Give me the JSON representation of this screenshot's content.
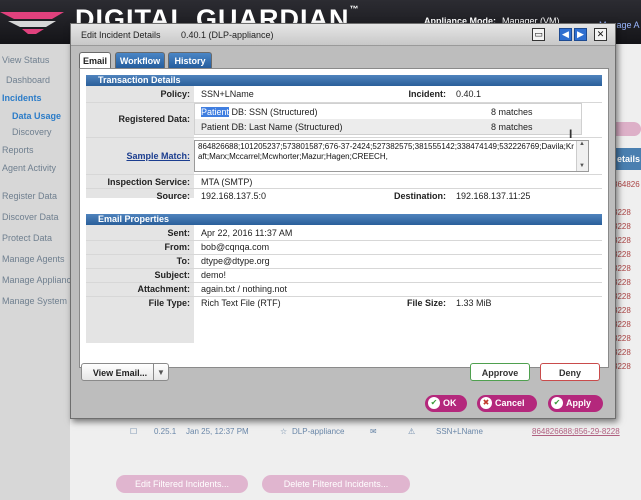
{
  "app": {
    "logo_text": "DIGITAL GUARDIAN",
    "logo_tm": "™",
    "appliance_mode_label": "Appliance Mode:",
    "appliance_mode_value": "Manager (VM)",
    "manage_link": "Manage A"
  },
  "sidebar": {
    "items": [
      {
        "label": "View Status"
      },
      {
        "label": "Dashboard"
      },
      {
        "label": "Incidents"
      },
      {
        "label": "Data Usage"
      },
      {
        "label": "Discovery"
      },
      {
        "label": "Reports"
      },
      {
        "label": "Agent Activity"
      },
      {
        "label": "Register Data"
      },
      {
        "label": "Discover Data"
      },
      {
        "label": "Protect Data"
      },
      {
        "label": "Manage Agents"
      },
      {
        "label": "Manage Applianc"
      },
      {
        "label": "Manage System"
      }
    ]
  },
  "background": {
    "details_header": "etails",
    "link_cells": [
      "864826",
      "",
      "3228",
      "3228",
      "3228",
      "3228",
      "3228",
      "3228",
      "3228",
      "3228",
      "3228",
      "3228",
      "3228",
      "3228"
    ],
    "row": {
      "id": "0.25.1",
      "date": "Jan 25, 12:37 PM",
      "source": "DLP-appliance",
      "policy": "SSN+LName",
      "data": "864826688;856-29-8228"
    },
    "edit_filtered": "Edit Filtered Incidents...",
    "delete_filtered": "Delete Filtered Incidents..."
  },
  "dialog": {
    "title": "Edit Incident Details",
    "subtitle": "0.40.1 (DLP-appliance)",
    "tabs": [
      {
        "label": "Email",
        "active": true
      },
      {
        "label": "Workflow",
        "active": false
      },
      {
        "label": "History",
        "active": false
      }
    ],
    "transaction": {
      "header": "Transaction Details",
      "policy_label": "Policy:",
      "policy_value": "SSN+LName",
      "incident_label": "Incident:",
      "incident_value": "0.40.1",
      "registered_label": "Registered Data:",
      "registered_rows": [
        {
          "name_hl": "Patient",
          "name_rest": " DB: SSN (Structured)",
          "count": "8 matches"
        },
        {
          "name_hl": "",
          "name_rest": "Patient DB: Last Name (Structured)",
          "count": "8 matches"
        }
      ],
      "sample_label": "Sample Match:",
      "sample_value": "864826688;101205237;573801587;676-37-2424;527382575;381555142;338474149;532226769;Davila;Kraft;Marx;Mccarrel;Mcwhorter;Mazur;Hagen;CREECH,",
      "inspection_label": "Inspection Service:",
      "inspection_value": "MTA (SMTP)",
      "source_label": "Source:",
      "source_value": "192.168.137.5:0",
      "destination_label": "Destination:",
      "destination_value": "192.168.137.11:25"
    },
    "email": {
      "header": "Email Properties",
      "sent_label": "Sent:",
      "sent_value": "Apr 22, 2016 11:37 AM",
      "from_label": "From:",
      "from_value": "bob@cqnqa.com",
      "to_label": "To:",
      "to_value": "dtype@dtype.org",
      "subject_label": "Subject:",
      "subject_value": "demo!",
      "attachment_label": "Attachment:",
      "attachment_value": "again.txt / nothing.not",
      "filetype_label": "File Type:",
      "filetype_value": "Rich Text File (RTF)",
      "filesize_label": "File Size:",
      "filesize_value": "1.33 MiB"
    },
    "buttons": {
      "view_email": "View Email...",
      "approve": "Approve",
      "deny": "Deny",
      "ok": "OK",
      "cancel": "Cancel",
      "apply": "Apply"
    }
  },
  "colors": {
    "accent_blue": "#2a5f9a",
    "tab_blue": "#255d9d",
    "action_magenta": "#b4287c",
    "approve_green": "#4fa04f",
    "deny_red": "#c94b4b",
    "link_navy": "#1b3d8f"
  }
}
